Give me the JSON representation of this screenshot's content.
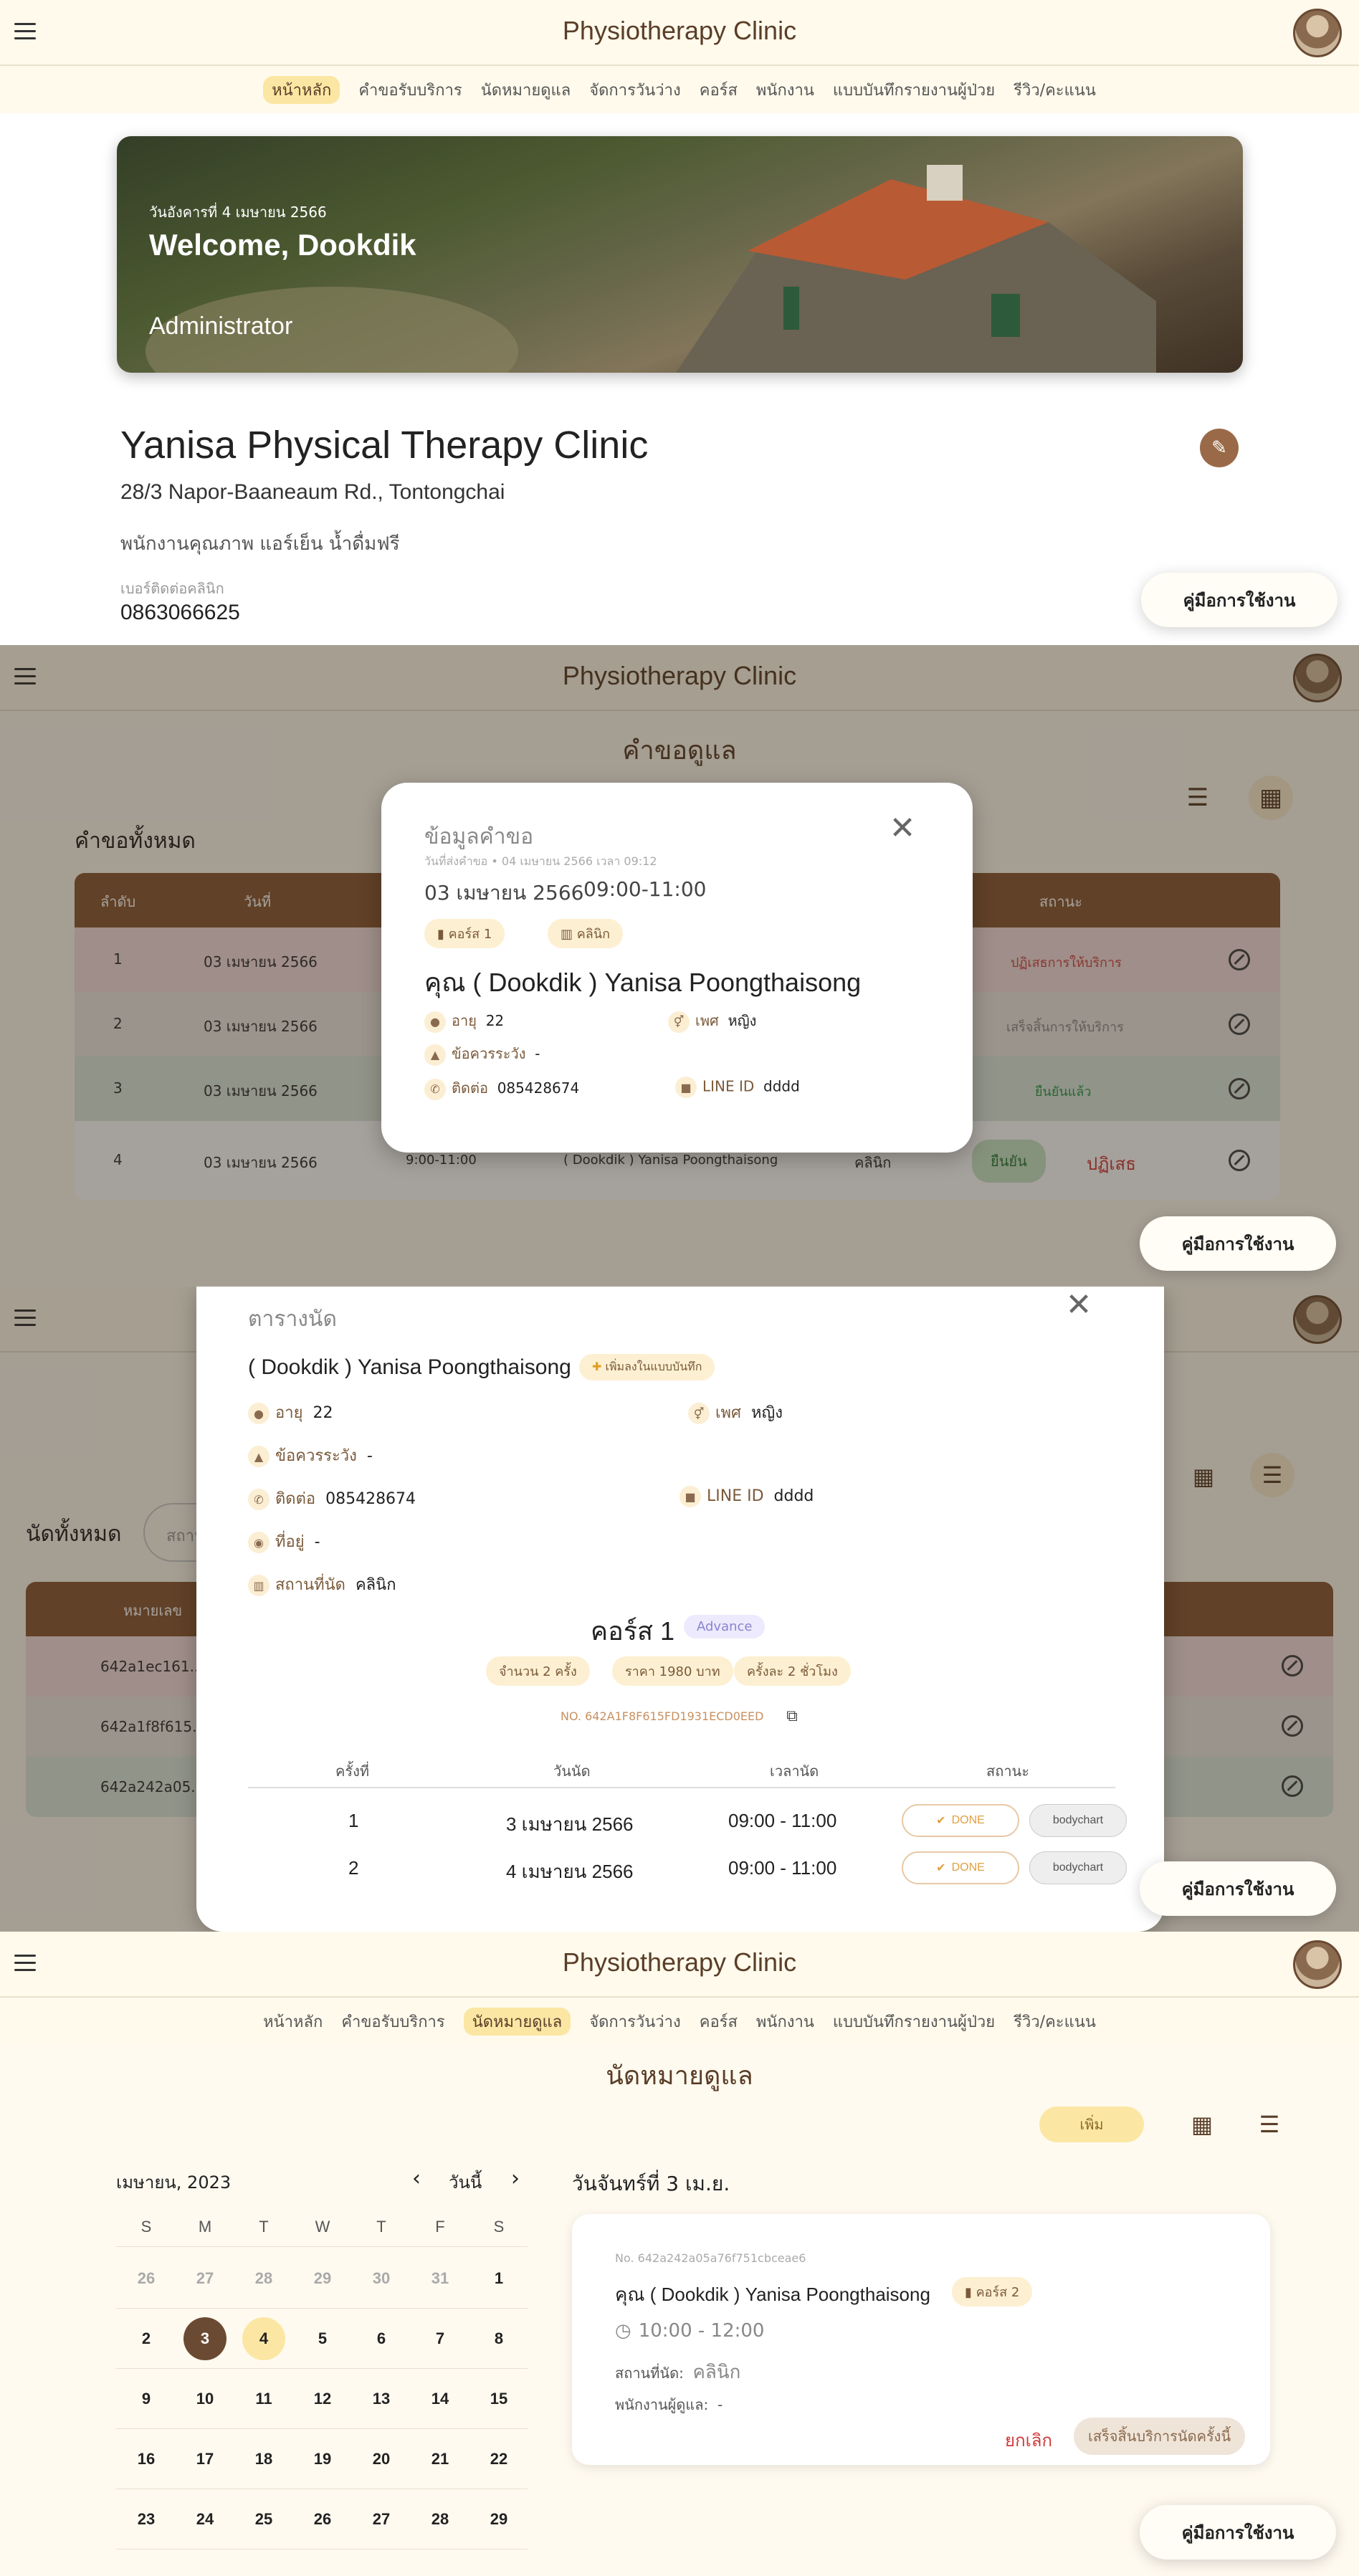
{
  "app": {
    "title": "Physiotherapy Clinic"
  },
  "nav": [
    "หน้าหลัก",
    "คำขอรับบริการ",
    "นัดหมายดูแล",
    "จัดการวันว่าง",
    "คอร์ส",
    "พนักงาน",
    "แบบบันทึกรายงานผู้ป่วย",
    "รีวิว/คะแนน"
  ],
  "guide_button": "คู่มือการใช้งาน",
  "home": {
    "date": "วันอังคารที่ 4 เมษายน 2566",
    "welcome": "Welcome, Dookdik",
    "role": "Administrator",
    "clinic_name": "Yanisa Physical Therapy Clinic",
    "address": "28/3 Napor-Baaneaum Rd., Tontongchai",
    "description": "พนักงานคุณภาพ แอร์เย็น น้ำดื่มฟรี",
    "phone_label": "เบอร์ติดต่อคลินิก",
    "phone": "0863066625"
  },
  "requests": {
    "page_title": "คำขอดูแล",
    "list_title": "คำขอทั้งหมด",
    "columns": [
      "ลำดับ",
      "วันที่",
      "สถานะ"
    ],
    "rows": [
      {
        "no": "1",
        "date": "03 เมษายน 2566",
        "status": "ปฏิเสธการให้บริการ",
        "color": "#f5dede"
      },
      {
        "no": "2",
        "date": "03 เมษายน 2566",
        "status": "เสร็จสิ้นการให้บริการ",
        "color": "#ece9e4"
      },
      {
        "no": "3",
        "date": "03 เมษายน 2566",
        "status": "ยืนยันแล้ว",
        "color": "#dde9df"
      },
      {
        "no": "4",
        "date": "03 เมษายน 2566",
        "time": "9:00-11:00",
        "name": "( Dookdik ) Yanisa Poongthaisong",
        "place": "คลินิก",
        "confirm": "ยืนยัน",
        "reject": "ปฏิเสธ",
        "color": "#ffffff"
      }
    ],
    "modal": {
      "title": "ข้อมูลคำขอ",
      "sent": "วันที่ส่งคำขอ • 04 เมษายน 2566 เวลา 09:12",
      "date": "03 เมษายน 2566",
      "time": "09:00-11:00",
      "course_chip": "คอร์ส 1",
      "place_chip": "คลินิก",
      "patient": "คุณ ( Dookdik ) Yanisa Poongthaisong",
      "age_label": "อายุ",
      "age": "22",
      "sex_label": "เพศ",
      "sex": "หญิง",
      "caution_label": "ข้อควรระวัง",
      "caution": "-",
      "contact_label": "ติดต่อ",
      "contact": "085428674",
      "line_label": "LINE ID",
      "line": "dddd"
    }
  },
  "schedule_modal": {
    "list_title": "นัดทั้งหมด",
    "status_placeholder": "สถานะ",
    "col_no": "หมายเลข",
    "list_rows": [
      "642a1ec161...",
      "642a1f8f615...",
      "642a242a05..."
    ],
    "title": "ตารางนัด",
    "patient": "( Dookdik ) Yanisa Poongthaisong",
    "add_note": "เพิ่มลงในแบบบันทึก",
    "age_label": "อายุ",
    "age": "22",
    "sex_label": "เพศ",
    "sex": "หญิง",
    "caution_label": "ข้อควรระวัง",
    "caution": "-",
    "contact_label": "ติดต่อ",
    "contact": "085428674",
    "line_label": "LINE ID",
    "line": "dddd",
    "address_label": "ที่อยู่",
    "address": "-",
    "place_label": "สถานที่นัด",
    "place": "คลินิก",
    "course": "คอร์ส 1",
    "course_badge": "Advance",
    "chips": [
      "จำนวน 2 ครั้ง",
      "ราคา 1980 บาท",
      "ครั้งละ 2 ชั่วโมง"
    ],
    "booking_no": "NO. 642A1F8F615FD1931ECD0EED",
    "columns": [
      "ครั้งที่",
      "วันนัด",
      "เวลานัด",
      "สถานะ"
    ],
    "rows": [
      {
        "no": "1",
        "date": "3 เมษายน 2566",
        "time": "09:00 - 11:00",
        "status": "DONE",
        "chart": "bodychart"
      },
      {
        "no": "2",
        "date": "4 เมษายน 2566",
        "time": "09:00 - 11:00",
        "status": "DONE",
        "chart": "bodychart"
      }
    ]
  },
  "appointments": {
    "page_title": "นัดหมายดูแล",
    "add": "เพิ่ม",
    "month": "เมษายน, 2023",
    "today": "วันนี้",
    "weekdays": [
      "S",
      "M",
      "T",
      "W",
      "T",
      "F",
      "S"
    ],
    "weeks": [
      [
        "26",
        "27",
        "28",
        "29",
        "30",
        "31",
        "1"
      ],
      [
        "2",
        "3",
        "4",
        "5",
        "6",
        "7",
        "8"
      ],
      [
        "9",
        "10",
        "11",
        "12",
        "13",
        "14",
        "15"
      ],
      [
        "16",
        "17",
        "18",
        "19",
        "20",
        "21",
        "22"
      ],
      [
        "23",
        "24",
        "25",
        "26",
        "27",
        "28",
        "29"
      ]
    ],
    "day_title": "วันจันทร์ที่ 3 เม.ย.",
    "card": {
      "no": "No. 642a242a05a76f751cbceae6",
      "name": "คุณ ( Dookdik ) Yanisa Poongthaisong",
      "course_chip": "คอร์ส 2",
      "time": "10:00 - 12:00",
      "place_label": "สถานที่นัด:",
      "place": "คลินิก",
      "staff_label": "พนักงานผู้ดูแล:",
      "staff": "-",
      "cancel": "ยกเลิก",
      "finish": "เสร็จสิ้นบริการนัดครั้งนี้"
    }
  }
}
